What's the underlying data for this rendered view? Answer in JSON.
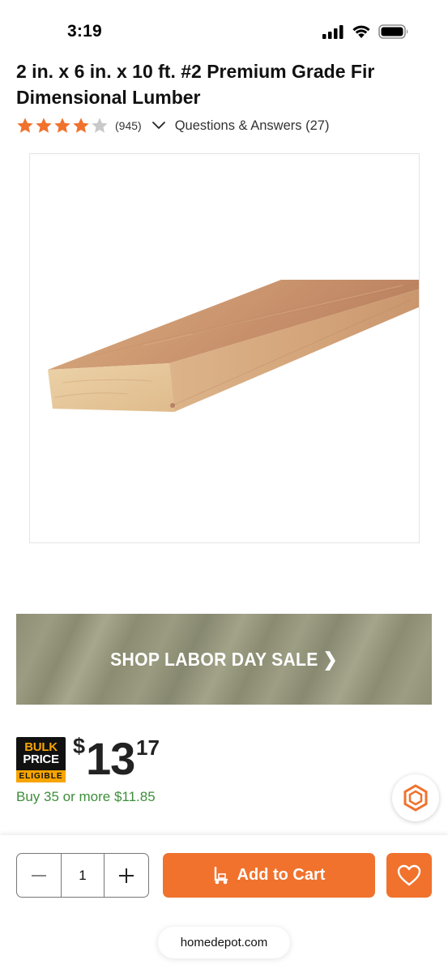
{
  "status_bar": {
    "time": "3:19"
  },
  "product": {
    "title": "2 in. x 6 in. x 10 ft. #2 Premium Grade Fir Dimensional Lumber",
    "rating": 4,
    "rating_max": 5,
    "review_count": "(945)",
    "qa_label": "Questions & Answers (27)"
  },
  "promo": {
    "label": "SHOP LABOR DAY SALE ❯"
  },
  "bulk_badge": {
    "line1": "BULK",
    "line2": "PRICE",
    "line3": "ELIGIBLE"
  },
  "price": {
    "currency": "$",
    "dollars": "13",
    "cents": "17"
  },
  "bulk_price_text": "Buy 35 or more $11.85",
  "cart": {
    "quantity": "1",
    "add_label": "Add to Cart"
  },
  "browser": {
    "url": "homedepot.com"
  },
  "colors": {
    "brand_orange": "#f0722d",
    "star": "#f0722d",
    "bulk_green": "#3d8e3a"
  },
  "icons": [
    "cellular-signal-icon",
    "wifi-icon",
    "battery-icon",
    "star-icon",
    "chevron-down-icon",
    "chat-assistant-icon",
    "minus-icon",
    "plus-icon",
    "hand-truck-icon",
    "heart-icon"
  ]
}
